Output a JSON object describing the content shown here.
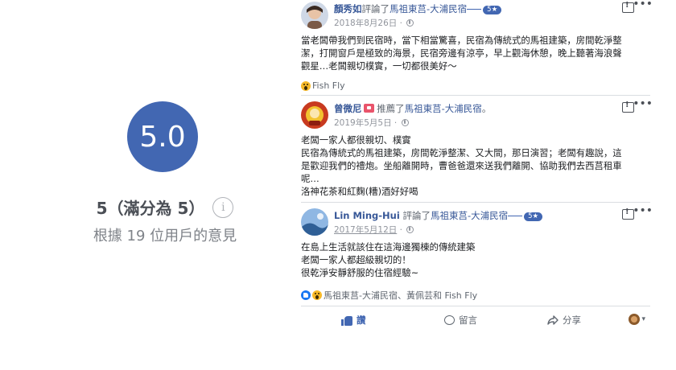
{
  "rating": {
    "score": "5.0",
    "summary": "5（滿分為 5）",
    "info_glyph": "i",
    "based_on": "根據 19 位用戶的意見",
    "circle_color": "#4267b2"
  },
  "reviews": [
    {
      "name": "顏秀如",
      "action": "評論了",
      "page": "馬祖東莒-大浦民宿",
      "badge": "5★",
      "date": "2018年8月26日",
      "body": [
        "當老闆帶我們到民宿時，當下相當驚喜，民宿為傳統式的馬祖建築，房間乾淨整",
        "潔，打開窗戶是極致的海景，民宿旁邊有涼亭，早上觀海休憩，晚上聽著海浪聲",
        "觀星…老闆親切樸實，一切都很美好～"
      ],
      "reactions": "Fish Fly"
    },
    {
      "name": "曾微尼",
      "action": "推薦了",
      "page": "馬祖東莒-大浦民宿",
      "page_suffix": "。",
      "date": "2019年5月5日",
      "body": [
        "老闆一家人都很親切、樸實",
        "民宿為傳統式的馬祖建築，房間乾淨整潔、又大間，那日演習；老闆有趣說，這",
        "是歡迎我們的禮炮。坐船離開時，曹爸爸還來送我們離開、協助我們去西莒租車",
        "呢…",
        "洛神花茶和紅麴(糟)酒好好喝"
      ]
    },
    {
      "name": "Lin Ming-Hui",
      "action": "評論了",
      "page": "馬祖東莒-大浦民宿",
      "badge": "5★",
      "date": "2017年5月12日",
      "body": [
        "在島上生活就該住在這海邊獨棟的傳統建築",
        "老闆一家人都超級親切的！",
        "很乾淨安靜舒服的住宿經驗~"
      ],
      "reactions": "馬祖東莒-大浦民宿、黃佩芸和 Fish Fly"
    }
  ],
  "actions": {
    "like": "讚",
    "comment": "留言",
    "share": "分享",
    "audience_caret": "▾"
  },
  "icons": {
    "message": "message-report-icon",
    "more": "•••",
    "globe": "globe-icon"
  }
}
